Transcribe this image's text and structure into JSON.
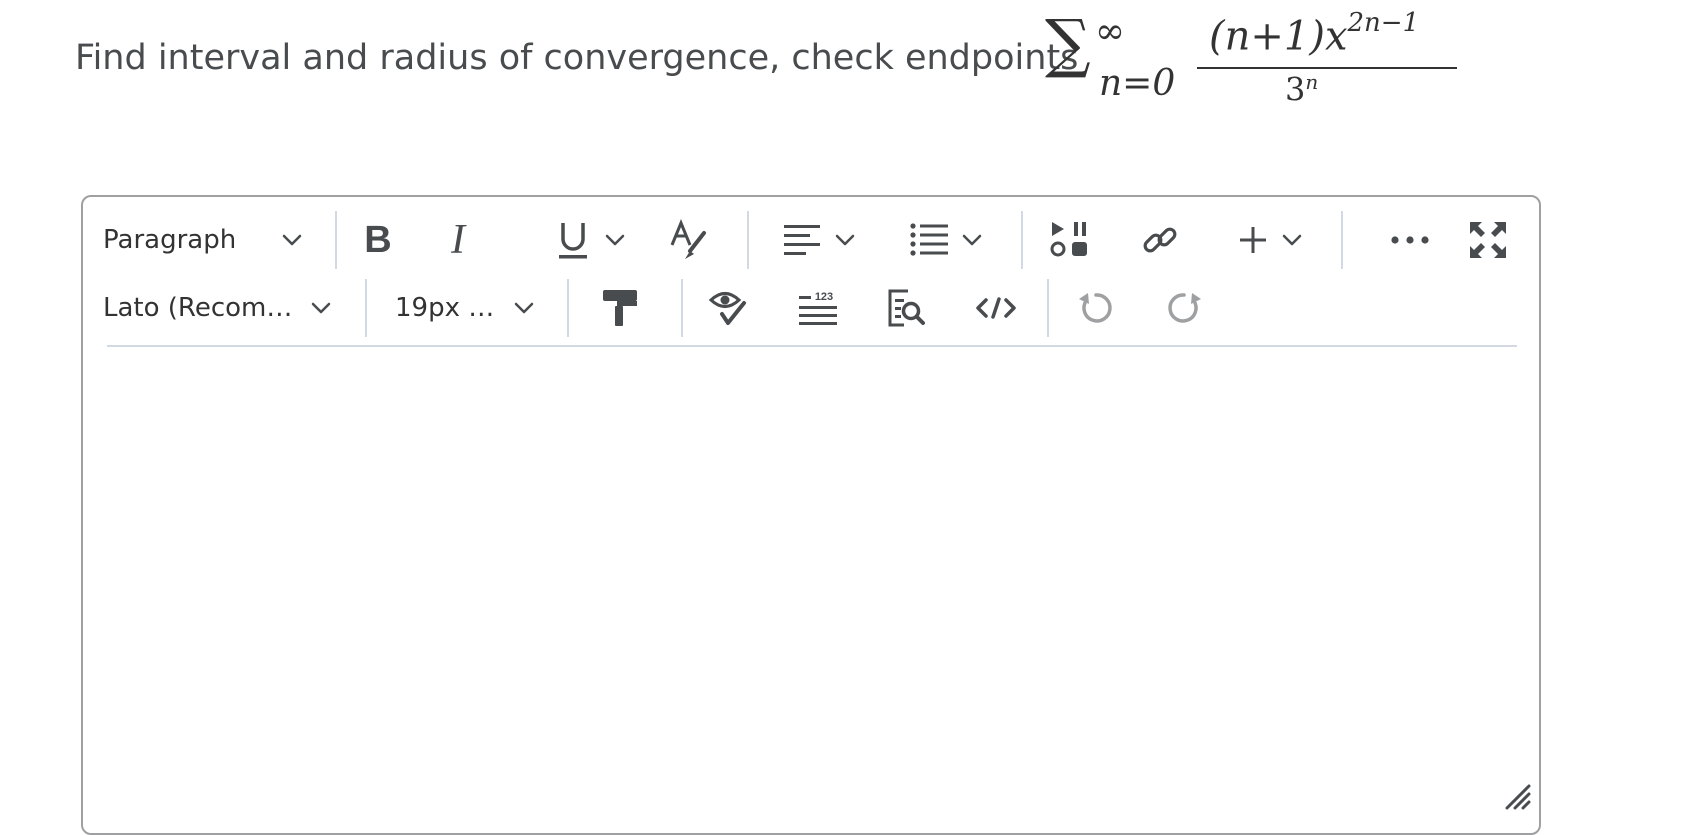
{
  "question": {
    "text": "Find interval and radius of convergence, check endpoints",
    "math": {
      "sigma": "∑",
      "upper": "∞",
      "lower": "n=0",
      "numerator_base": "(n+1)x",
      "numerator_exp": "2n−1",
      "denominator_base": "3",
      "denominator_exp": "n"
    }
  },
  "toolbar": {
    "paragraph_label": "Paragraph",
    "font_label": "Lato (Recom…",
    "size_label": "19px …"
  },
  "icons": {
    "chevron": "chevron-down-icon",
    "bold": "bold-icon",
    "italic": "italic-icon",
    "underline": "underline-icon",
    "text_color": "text-color-icon",
    "align": "align-left-icon",
    "list": "bulleted-list-icon",
    "media": "media-icon",
    "link": "link-icon",
    "insert": "plus-icon",
    "more": "more-icon",
    "fullscreen": "fullscreen-icon",
    "format_painter": "format-painter-icon",
    "accessibility": "accessibility-checker-icon",
    "word_count": "word-count-icon",
    "preview": "preview-icon",
    "source": "source-code-icon",
    "undo": "undo-icon",
    "redo": "redo-icon",
    "resize": "resize-handle-icon"
  },
  "colors": {
    "icon": "#494c4e",
    "disabled_icon": "#9ea0a2",
    "border": "#9ea0a2",
    "divider": "#d3d9e3"
  }
}
